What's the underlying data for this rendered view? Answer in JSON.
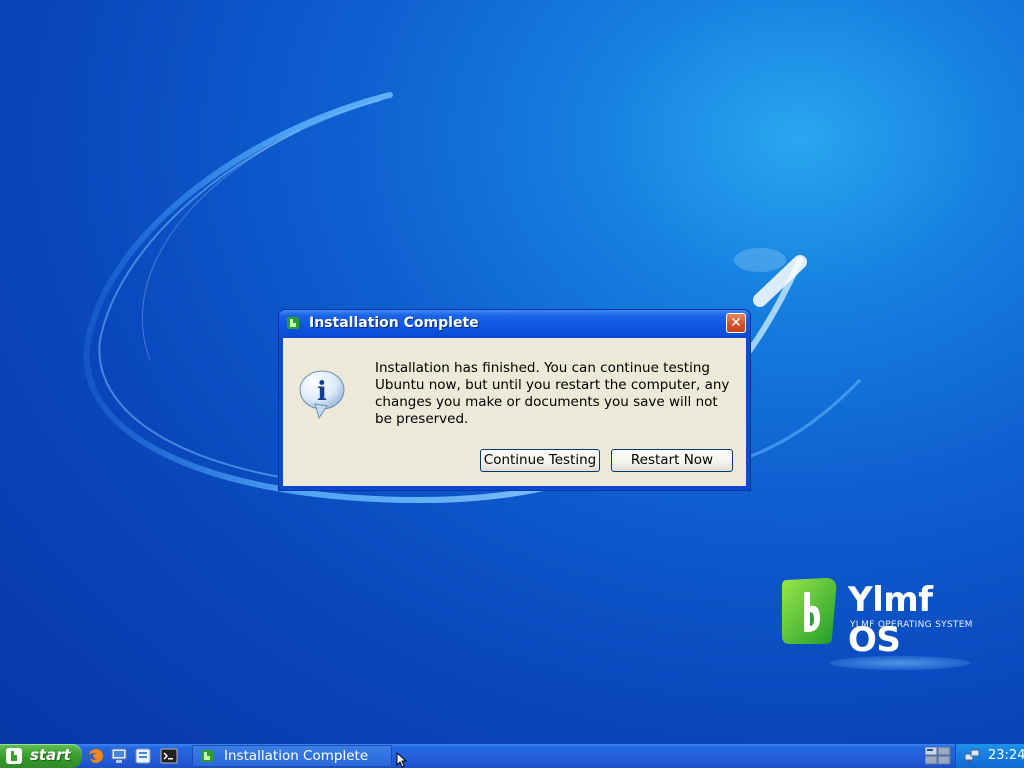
{
  "dialog": {
    "title": "Installation Complete",
    "close_label": "✕",
    "message": "Installation has finished.  You can continue testing Ubuntu now, but until you restart the computer, any changes you make or documents you save will not be preserved.",
    "continue_button": "Continue Testing",
    "restart_button": "Restart Now"
  },
  "logo": {
    "title": "Ylmf OS",
    "subtitle": "YLMF OPERATING SYSTEM"
  },
  "taskbar": {
    "start_label": "start",
    "quick_launch": [
      {
        "icon": "firefox-icon"
      },
      {
        "icon": "computer-icon"
      },
      {
        "icon": "files-icon"
      },
      {
        "icon": "terminal-icon"
      }
    ],
    "task_label": "Installation Complete",
    "clock": "23:24"
  },
  "colors": {
    "titlebar_blue": "#0d55e2",
    "taskbar_blue": "#245edb",
    "start_green": "#3a9d2f",
    "close_red": "#d4502a",
    "dialog_bg": "#ece9d8"
  }
}
